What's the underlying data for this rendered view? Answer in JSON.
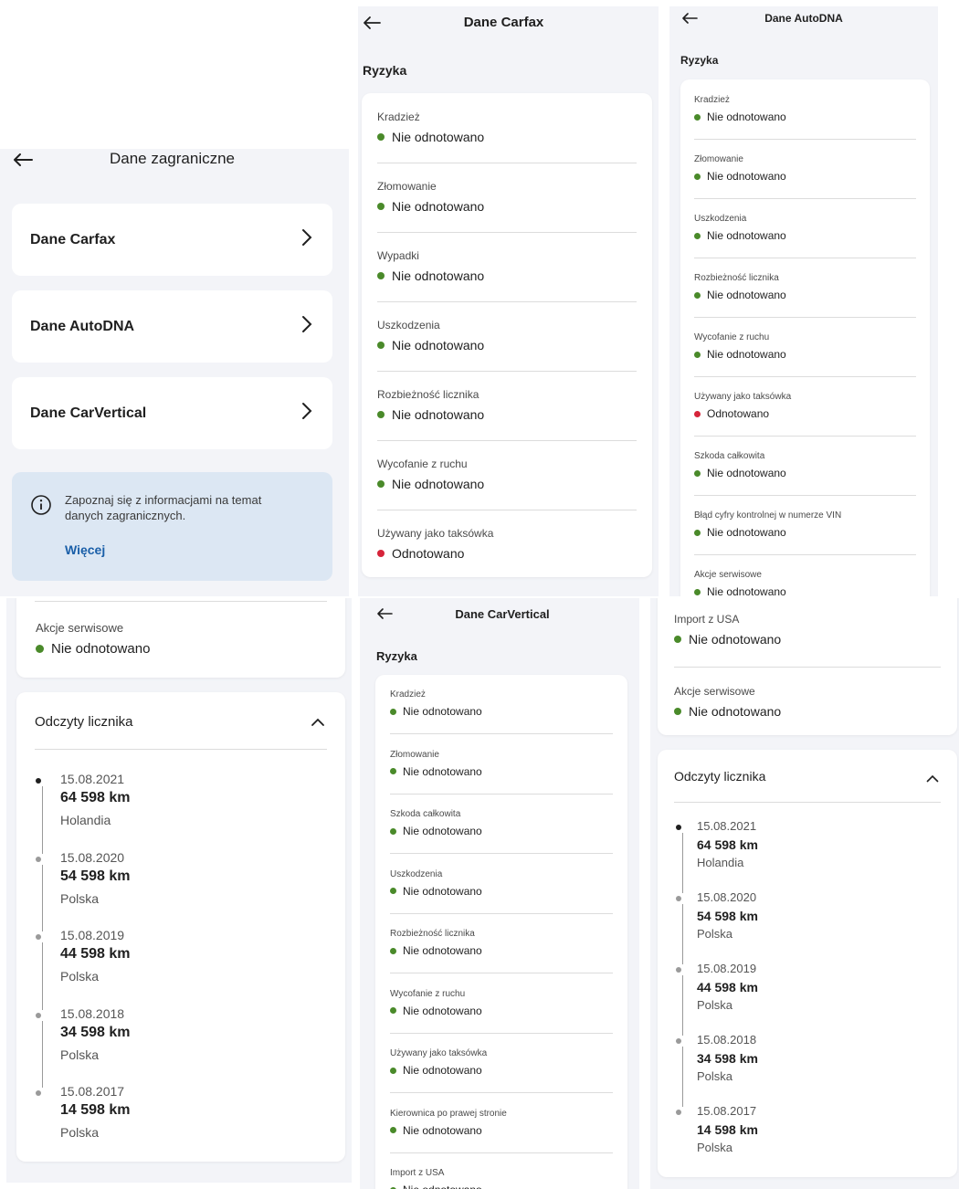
{
  "colors": {
    "ok": "#4a8a2a",
    "alert": "#d6243a",
    "link": "#1a5fa8",
    "info_bg": "#dce7f3",
    "screen_bg": "#f3f4f8"
  },
  "foreign": {
    "title": "Dane zagraniczne",
    "items": [
      {
        "label": "Dane Carfax"
      },
      {
        "label": "Dane AutoDNA"
      },
      {
        "label": "Dane CarVertical"
      }
    ],
    "info_text": "Zapoznaj się z informacjami na temat danych zagranicznych.",
    "info_link": "Więcej"
  },
  "carfax": {
    "title": "Dane Carfax",
    "section": "Ryzyka",
    "risks": [
      {
        "label": "Kradzież",
        "value": "Nie odnotowano",
        "status": "ok"
      },
      {
        "label": "Złomowanie",
        "value": "Nie odnotowano",
        "status": "ok"
      },
      {
        "label": "Wypadki",
        "value": "Nie odnotowano",
        "status": "ok"
      },
      {
        "label": "Uszkodzenia",
        "value": "Nie odnotowano",
        "status": "ok"
      },
      {
        "label": "Rozbieżność licznika",
        "value": "Nie odnotowano",
        "status": "ok"
      },
      {
        "label": "Wycofanie z ruchu",
        "value": "Nie odnotowano",
        "status": "ok"
      },
      {
        "label": "Używany jako taksówka",
        "value": "Odnotowano",
        "status": "alert"
      }
    ]
  },
  "autodna": {
    "title": "Dane AutoDNA",
    "section": "Ryzyka",
    "risks": [
      {
        "label": "Kradzież",
        "value": "Nie odnotowano",
        "status": "ok"
      },
      {
        "label": "Złomowanie",
        "value": "Nie odnotowano",
        "status": "ok"
      },
      {
        "label": "Uszkodzenia",
        "value": "Nie odnotowano",
        "status": "ok"
      },
      {
        "label": "Rozbieżność licznika",
        "value": "Nie odnotowano",
        "status": "ok"
      },
      {
        "label": "Wycofanie z ruchu",
        "value": "Nie odnotowano",
        "status": "ok"
      },
      {
        "label": "Używany jako taksówka",
        "value": "Odnotowano",
        "status": "alert"
      },
      {
        "label": "Szkoda całkowita",
        "value": "Nie odnotowano",
        "status": "ok"
      },
      {
        "label": "Błąd cyfry kontrolnej w numerze VIN",
        "value": "Nie odnotowano",
        "status": "ok"
      },
      {
        "label": "Akcje serwisowe",
        "value": "Nie odnotowano",
        "status": "ok"
      }
    ]
  },
  "carvertical": {
    "title": "Dane CarVertical",
    "section": "Ryzyka",
    "risks": [
      {
        "label": "Kradzież",
        "value": "Nie odnotowano",
        "status": "ok"
      },
      {
        "label": "Złomowanie",
        "value": "Nie odnotowano",
        "status": "ok"
      },
      {
        "label": "Szkoda całkowita",
        "value": "Nie odnotowano",
        "status": "ok"
      },
      {
        "label": "Uszkodzenia",
        "value": "Nie odnotowano",
        "status": "ok"
      },
      {
        "label": "Rozbieżność licznika",
        "value": "Nie odnotowano",
        "status": "ok"
      },
      {
        "label": "Wycofanie z ruchu",
        "value": "Nie odnotowano",
        "status": "ok"
      },
      {
        "label": "Używany jako taksówka",
        "value": "Nie odnotowano",
        "status": "ok"
      },
      {
        "label": "Kierownica po prawej stronie",
        "value": "Nie odnotowano",
        "status": "ok"
      },
      {
        "label": "Import z USA",
        "value": "Nie odnotowano",
        "status": "ok"
      }
    ]
  },
  "carfax_bottom": {
    "risk": {
      "label": "Akcje serwisowe",
      "value": "Nie odnotowano",
      "status": "ok"
    },
    "odometer_title": "Odczyty licznika",
    "readings": [
      {
        "date": "15.08.2021",
        "km": "64 598 km",
        "country": "Holandia"
      },
      {
        "date": "15.08.2020",
        "km": "54 598 km",
        "country": "Polska"
      },
      {
        "date": "15.08.2019",
        "km": "44 598 km",
        "country": "Polska"
      },
      {
        "date": "15.08.2018",
        "km": "34 598 km",
        "country": "Polska"
      },
      {
        "date": "15.08.2017",
        "km": "14 598 km",
        "country": "Polska"
      }
    ]
  },
  "cv_bottom": {
    "risks": [
      {
        "label": "Import z USA",
        "value": "Nie odnotowano",
        "status": "ok"
      },
      {
        "label": "Akcje serwisowe",
        "value": "Nie odnotowano",
        "status": "ok"
      }
    ],
    "odometer_title": "Odczyty licznika",
    "readings": [
      {
        "date": "15.08.2021",
        "km": "64 598 km",
        "country": "Holandia"
      },
      {
        "date": "15.08.2020",
        "km": "54 598 km",
        "country": "Polska"
      },
      {
        "date": "15.08.2019",
        "km": "44 598 km",
        "country": "Polska"
      },
      {
        "date": "15.08.2018",
        "km": "34 598 km",
        "country": "Polska"
      },
      {
        "date": "15.08.2017",
        "km": "14 598 km",
        "country": "Polska"
      }
    ]
  }
}
